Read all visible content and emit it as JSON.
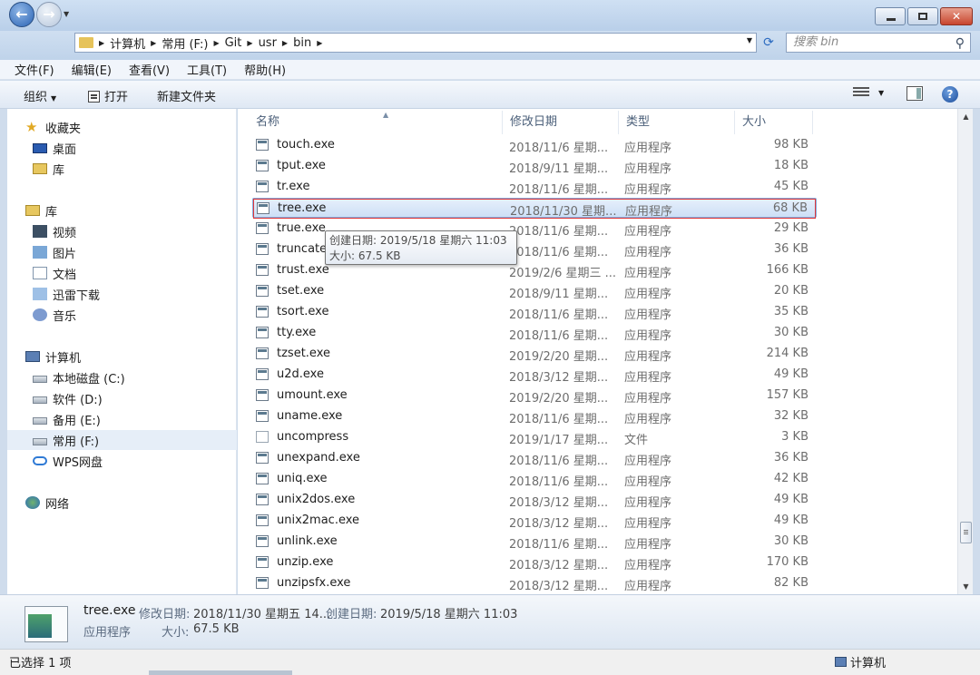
{
  "address": {
    "crumbs": [
      "计算机",
      "常用 (F:)",
      "Git",
      "usr",
      "bin"
    ]
  },
  "search": {
    "placeholder": "搜索 bin"
  },
  "menu": [
    "文件(F)",
    "编辑(E)",
    "查看(V)",
    "工具(T)",
    "帮助(H)"
  ],
  "commands": {
    "organize": "组织",
    "open": "打开",
    "new_folder": "新建文件夹"
  },
  "sidebar": {
    "favorites": {
      "label": "收藏夹",
      "items": [
        "桌面",
        "库"
      ]
    },
    "libraries": {
      "label": "库",
      "items": [
        "视频",
        "图片",
        "文档",
        "迅雷下载",
        "音乐"
      ]
    },
    "computer": {
      "label": "计算机",
      "items": [
        "本地磁盘 (C:)",
        "软件 (D:)",
        "备用 (E:)",
        "常用 (F:)",
        "WPS网盘"
      ]
    },
    "network": {
      "label": "网络"
    }
  },
  "columns": {
    "name": "名称",
    "date": "修改日期",
    "type": "类型",
    "size": "大小"
  },
  "files": [
    {
      "name": "touch.exe",
      "date": "2018/11/6 星期...",
      "type": "应用程序",
      "size": "98 KB"
    },
    {
      "name": "tput.exe",
      "date": "2018/9/11 星期...",
      "type": "应用程序",
      "size": "18 KB"
    },
    {
      "name": "tr.exe",
      "date": "2018/11/6 星期...",
      "type": "应用程序",
      "size": "45 KB"
    },
    {
      "name": "tree.exe",
      "date": "2018/11/30 星期...",
      "type": "应用程序",
      "size": "68 KB",
      "selected": true
    },
    {
      "name": "true.exe",
      "date": "2018/11/6 星期...",
      "type": "应用程序",
      "size": "29 KB"
    },
    {
      "name": "truncate",
      "date": "2018/11/6 星期...",
      "type": "应用程序",
      "size": "36 KB"
    },
    {
      "name": "trust.exe",
      "date": "2019/2/6 星期三 ...",
      "type": "应用程序",
      "size": "166 KB"
    },
    {
      "name": "tset.exe",
      "date": "2018/9/11 星期...",
      "type": "应用程序",
      "size": "20 KB"
    },
    {
      "name": "tsort.exe",
      "date": "2018/11/6 星期...",
      "type": "应用程序",
      "size": "35 KB"
    },
    {
      "name": "tty.exe",
      "date": "2018/11/6 星期...",
      "type": "应用程序",
      "size": "30 KB"
    },
    {
      "name": "tzset.exe",
      "date": "2019/2/20 星期...",
      "type": "应用程序",
      "size": "214 KB"
    },
    {
      "name": "u2d.exe",
      "date": "2018/3/12 星期...",
      "type": "应用程序",
      "size": "49 KB"
    },
    {
      "name": "umount.exe",
      "date": "2019/2/20 星期...",
      "type": "应用程序",
      "size": "157 KB"
    },
    {
      "name": "uname.exe",
      "date": "2018/11/6 星期...",
      "type": "应用程序",
      "size": "32 KB"
    },
    {
      "name": "uncompress",
      "date": "2019/1/17 星期...",
      "type": "文件",
      "size": "3 KB",
      "plain": true
    },
    {
      "name": "unexpand.exe",
      "date": "2018/11/6 星期...",
      "type": "应用程序",
      "size": "36 KB"
    },
    {
      "name": "uniq.exe",
      "date": "2018/11/6 星期...",
      "type": "应用程序",
      "size": "42 KB"
    },
    {
      "name": "unix2dos.exe",
      "date": "2018/3/12 星期...",
      "type": "应用程序",
      "size": "49 KB"
    },
    {
      "name": "unix2mac.exe",
      "date": "2018/3/12 星期...",
      "type": "应用程序",
      "size": "49 KB"
    },
    {
      "name": "unlink.exe",
      "date": "2018/11/6 星期...",
      "type": "应用程序",
      "size": "30 KB"
    },
    {
      "name": "unzip.exe",
      "date": "2018/3/12 星期...",
      "type": "应用程序",
      "size": "170 KB"
    },
    {
      "name": "unzipsfx.exe",
      "date": "2018/3/12 星期...",
      "type": "应用程序",
      "size": "82 KB"
    }
  ],
  "tooltip": {
    "created": "创建日期: 2019/5/18 星期六 11:03",
    "size": "大小: 67.5 KB"
  },
  "details": {
    "name": "tree.exe",
    "modified_label": "修改日期:",
    "modified_value": "2018/11/30 星期五 14...",
    "created_label": "创建日期:",
    "created_value": "2019/5/18 星期六 11:03",
    "type": "应用程序",
    "size_label": "大小:",
    "size_value": "67.5 KB"
  },
  "status": {
    "selected": "已选择 1 项",
    "location": "计算机"
  }
}
